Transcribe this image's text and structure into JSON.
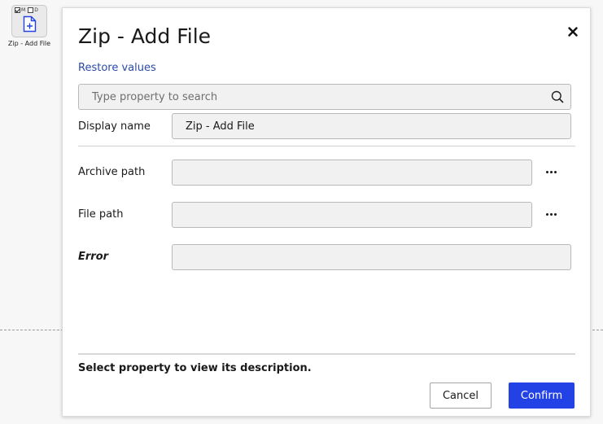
{
  "canvas": {
    "activity": {
      "flag_m": "M",
      "flag_d": "D",
      "label": "Zip - Add File",
      "icon": "file-add-icon"
    }
  },
  "dialog": {
    "title": "Zip - Add File",
    "close_icon": "close-icon",
    "restore_label": "Restore values",
    "search": {
      "placeholder": "Type property to search",
      "value": "",
      "icon": "search-icon"
    },
    "properties": {
      "display_name": {
        "label": "Display name",
        "value": "Zip - Add File"
      },
      "archive_path": {
        "label": "Archive path",
        "value": ""
      },
      "file_path": {
        "label": "File path",
        "value": ""
      },
      "error": {
        "label": "Error",
        "value": ""
      }
    },
    "description": "Select property to view its description.",
    "buttons": {
      "cancel": "Cancel",
      "confirm": "Confirm"
    }
  },
  "colors": {
    "accent": "#2342e6",
    "link": "#2a4aa8",
    "field_bg": "#f1f1f1",
    "canvas_bg": "#f7f7f7"
  }
}
